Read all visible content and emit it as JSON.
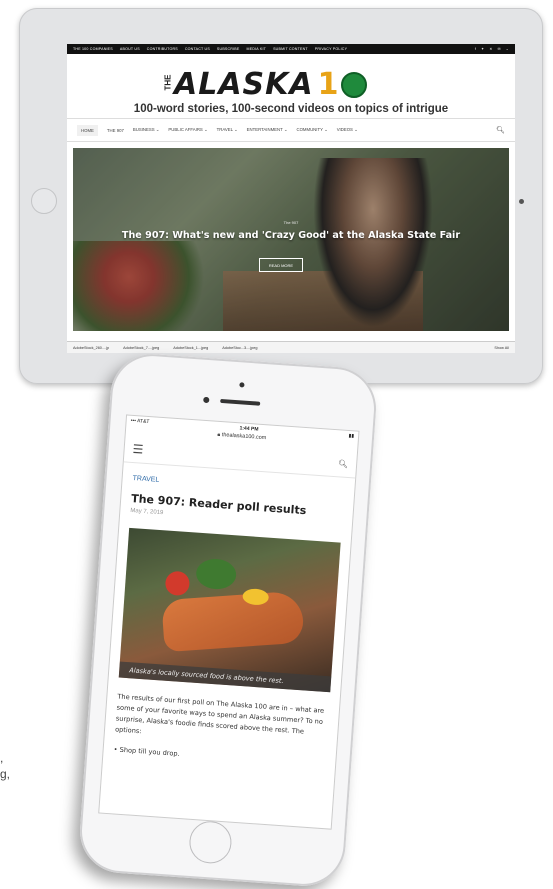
{
  "ipad": {
    "topbar": [
      "THE 100 COMPANIES",
      "ABOUT US",
      "CONTRIBUTORS",
      "CONTACT US",
      "SUBSCRIBE",
      "MEDIA KIT",
      "SUBMIT CONTENT",
      "PRIVACY POLICY"
    ],
    "social_icons": [
      "f",
      "✦",
      "✕",
      "✉",
      "⌄"
    ],
    "logo": {
      "the": "THE",
      "word": "ALASKA",
      "num": "1"
    },
    "tagline": "100-word stories, 100-second videos on topics of intrigue",
    "nav": [
      "HOME",
      "THE 907",
      "BUSINESS ⌄",
      "PUBLIC AFFAIRS ⌄",
      "TRAVEL ⌄",
      "ENTERTAINMENT ⌄",
      "COMMUNITY ⌄",
      "VIDEOS ⌄"
    ],
    "hero": {
      "category": "The 907",
      "title": "The 907: What's new and 'Crazy Good' at the Alaska State Fair",
      "button": "READ MORE"
    },
    "downloads": [
      "AdobeStock_260....jp",
      "AdobeStock_7....jpeg",
      "AdobeStock_1...jpeg",
      "AdobeStoc...3....jpeg"
    ],
    "show_all": "Show All"
  },
  "iphone": {
    "carrier": "••• AT&T",
    "time": "1:44 PM",
    "url": "thealaska100.com",
    "article": {
      "category": "TRAVEL",
      "title": "The 907: Reader poll results",
      "date": "May 7, 2019",
      "caption": "Alaska's locally sourced food is above the rest.",
      "body": "The results of our first poll on The Alaska 100 are in – what are some of your favorite ways to spend an Alaska summer? To no surprise, Alaska's foodie finds scored above the rest. The options:",
      "bullet": "• Shop till you drop."
    }
  },
  "stray_text": [
    ",",
    "g,"
  ]
}
